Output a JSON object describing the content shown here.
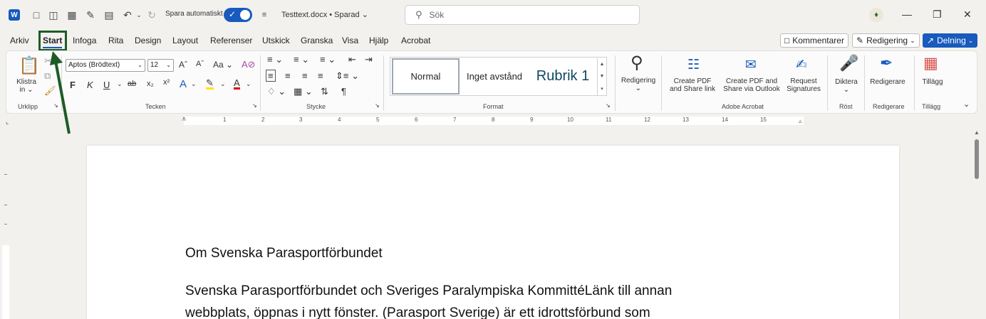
{
  "titlebar": {
    "app_icon": "word-icon",
    "autosave_label": "Spara automatiskt",
    "document_title": "Testtext.docx • Sparad",
    "search_placeholder": "Sök"
  },
  "menu": {
    "tabs": [
      "Arkiv",
      "Start",
      "Infoga",
      "Rita",
      "Design",
      "Layout",
      "Referenser",
      "Utskick",
      "Granska",
      "Visa",
      "Hjälp",
      "Acrobat"
    ],
    "active_tab": "Start",
    "comments_label": "Kommentarer",
    "editing_label": "Redigering",
    "share_label": "Delning"
  },
  "ribbon": {
    "clipboard": {
      "paste_label": "Klistra",
      "paste_sub": "in",
      "group_label": "Urklipp"
    },
    "font": {
      "font_name": "Aptos (Brödtext)",
      "font_size": "12",
      "bold": "F",
      "italic": "K",
      "underline": "U",
      "group_label": "Tecken"
    },
    "paragraph": {
      "group_label": "Stycke"
    },
    "styles": {
      "normal": "Normal",
      "no_spacing": "Inget avstånd",
      "heading1": "Rubrik 1",
      "group_label": "Format"
    },
    "editing": {
      "label": "Redigering"
    },
    "acrobat": {
      "create_pdf_share_link": "Create PDF and Share link",
      "create_pdf_outlook": "Create PDF and Share via Outlook",
      "request_signatures": "Request Signatures",
      "group_label": "Adobe Acrobat"
    },
    "voice": {
      "dictate": "Diktera",
      "group_label": "Röst"
    },
    "editor": {
      "label": "Redigerare",
      "group_label": "Redigerare"
    },
    "addins": {
      "label": "Tillägg",
      "group_label": "Tillägg"
    }
  },
  "ruler": {
    "numbers": [
      "1",
      "2",
      "3",
      "4",
      "5",
      "6",
      "7",
      "8",
      "9",
      "10",
      "11",
      "12",
      "13",
      "14",
      "15"
    ]
  },
  "document": {
    "heading": "Om Svenska Parasportförbundet",
    "body_line1": "Svenska Parasportförbundet och Sveriges Paralympiska KommittéLänk till annan",
    "body_line2": "webbplats, öppnas i nytt fönster. (Parasport Sverige) är ett idrottsförbund som"
  },
  "colors": {
    "accent": "#185abd",
    "highlight_frame": "#1e5b26"
  }
}
